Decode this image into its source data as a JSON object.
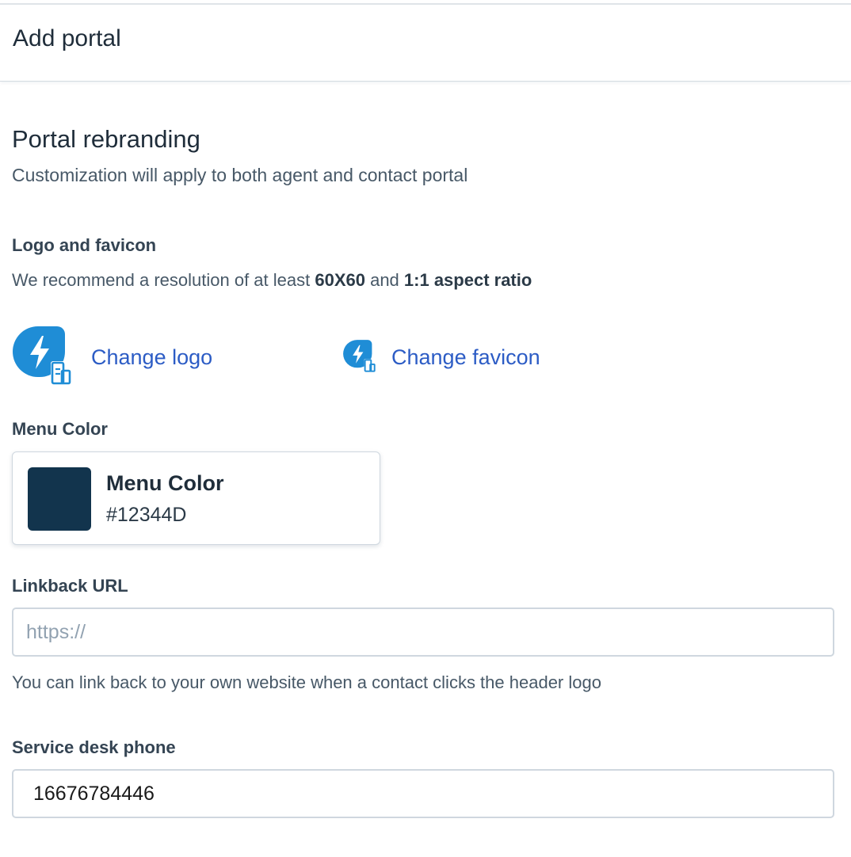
{
  "header": {
    "title": "Add portal"
  },
  "section": {
    "title": "Portal rebranding",
    "description": "Customization will apply to both agent and contact portal"
  },
  "logo": {
    "label": "Logo and favicon",
    "help_prefix": "We recommend a resolution of at least ",
    "help_resolution": "60X60",
    "help_mid": " and ",
    "help_ratio": "1:1 aspect ratio",
    "change_logo": "Change logo",
    "change_favicon": "Change favicon",
    "icon_color": "#1f8dd6"
  },
  "menu_color": {
    "label": "Menu Color",
    "card_title": "Menu Color",
    "hex": "#12344D"
  },
  "linkback": {
    "label": "Linkback URL",
    "placeholder": "https://",
    "value": "",
    "help": "You can link back to your own website when a contact clicks the header logo"
  },
  "phone": {
    "label": "Service desk phone",
    "value": "16676784446"
  }
}
